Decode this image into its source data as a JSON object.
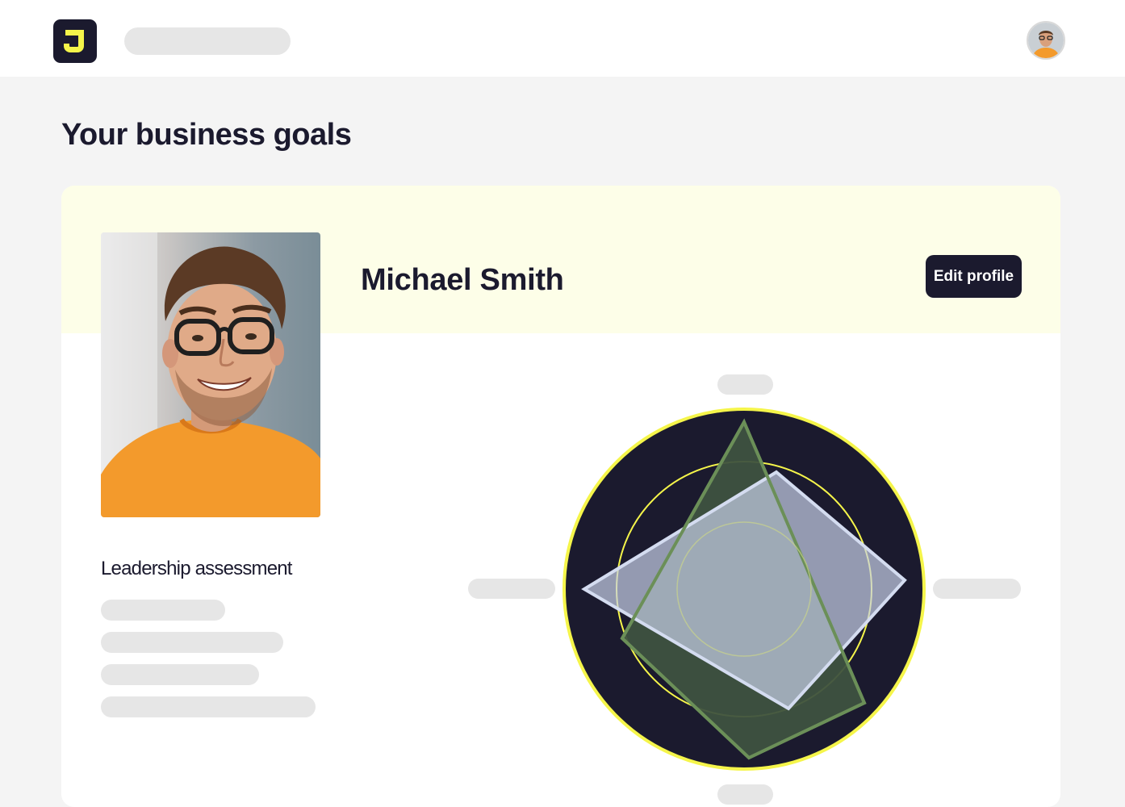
{
  "header": {
    "logo_letter": "J",
    "logo_icon": "brand-logo-icon",
    "avatar_icon": "user-avatar-icon"
  },
  "page": {
    "title": "Your business goals"
  },
  "profile": {
    "name": "Michael Smith",
    "edit_label": "Edit profile",
    "photo_icon": "profile-photo"
  },
  "assessment": {
    "title": "Leadership assessment"
  },
  "colors": {
    "brand_dark": "#1b1a2e",
    "accent_yellow": "#f5f54a",
    "header_tint": "#fdfee8",
    "skeleton": "#e6e6e6",
    "radar_green": "#6b8f58",
    "radar_blue": "#c7d2ea"
  }
}
